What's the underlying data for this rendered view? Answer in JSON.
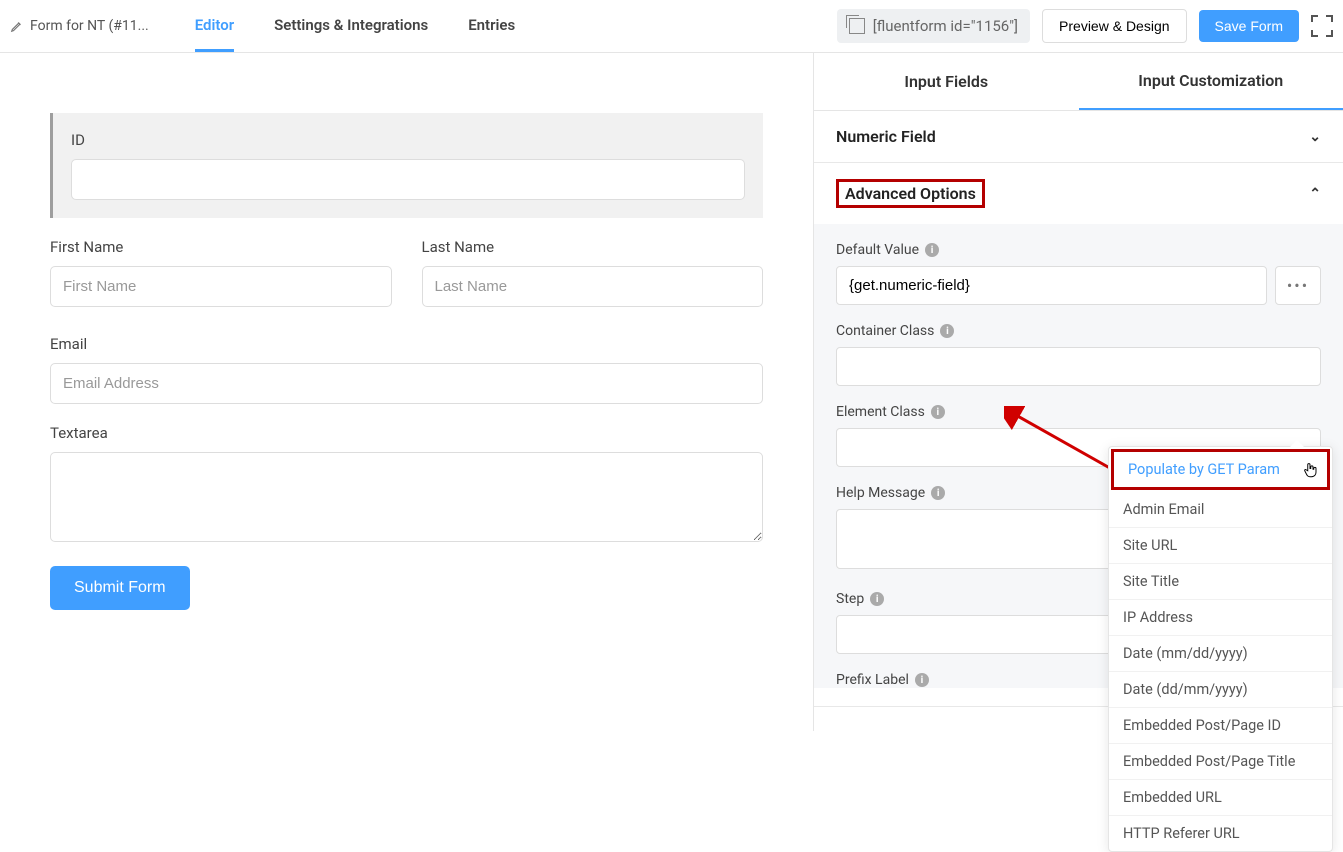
{
  "topbar": {
    "form_title": "Form for NT (#11...",
    "tabs": [
      "Editor",
      "Settings & Integrations",
      "Entries"
    ],
    "active_tab": 0,
    "shortcode": "[fluentform id=\"1156\"]",
    "preview_btn": "Preview & Design",
    "save_btn": "Save Form"
  },
  "canvas": {
    "id_field": {
      "label": "ID",
      "value": ""
    },
    "first_name": {
      "label": "First Name",
      "placeholder": "First Name"
    },
    "last_name": {
      "label": "Last Name",
      "placeholder": "Last Name"
    },
    "email": {
      "label": "Email",
      "placeholder": "Email Address"
    },
    "textarea": {
      "label": "Textarea",
      "value": ""
    },
    "submit": "Submit Form"
  },
  "panel": {
    "tabs": [
      "Input Fields",
      "Input Customization"
    ],
    "active_tab": 1,
    "numeric_section": "Numeric Field",
    "advanced_section": "Advanced Options",
    "default_value_label": "Default Value",
    "default_value": "{get.numeric-field}",
    "container_class_label": "Container Class",
    "element_class_label": "Element Class",
    "help_message_label": "Help Message",
    "step_label": "Step",
    "prefix_label": "Prefix Label",
    "popover_items": [
      "Populate by GET Param",
      "Admin Email",
      "Site URL",
      "Site Title",
      "IP Address",
      "Date (mm/dd/yyyy)",
      "Date (dd/mm/yyyy)",
      "Embedded Post/Page ID",
      "Embedded Post/Page Title",
      "Embedded URL",
      "HTTP Referer URL"
    ]
  }
}
